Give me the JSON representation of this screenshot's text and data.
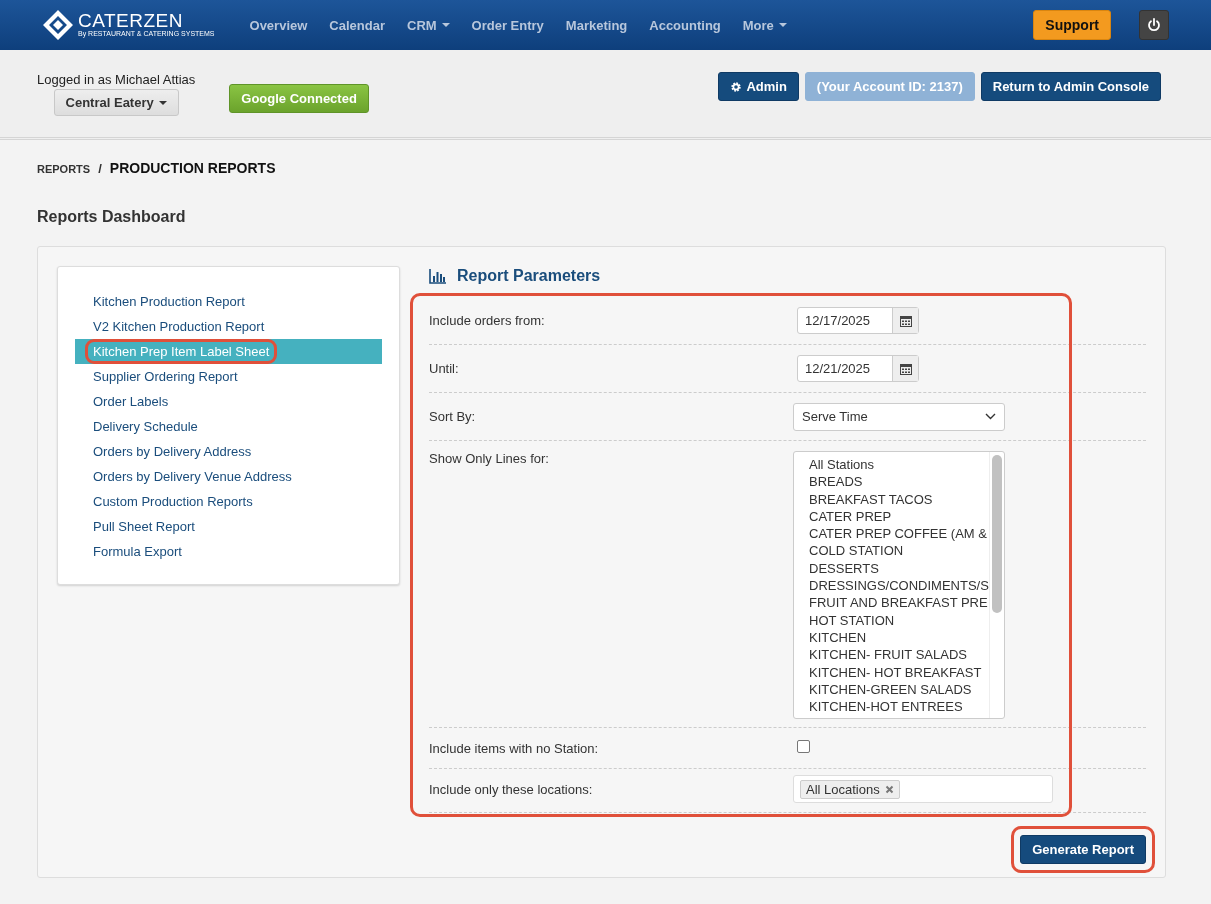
{
  "nav": {
    "logo": "CATERZEN",
    "tagline": "By RESTAURANT & CATERING SYSTEMS",
    "items": [
      {
        "label": "Overview",
        "dropdown": false
      },
      {
        "label": "Calendar",
        "dropdown": false
      },
      {
        "label": "CRM",
        "dropdown": true
      },
      {
        "label": "Order Entry",
        "dropdown": false
      },
      {
        "label": "Marketing",
        "dropdown": false
      },
      {
        "label": "Accounting",
        "dropdown": false
      },
      {
        "label": "More",
        "dropdown": true
      }
    ],
    "support": "Support"
  },
  "header": {
    "logged_in": "Logged in as Michael Attias",
    "location": "Central Eatery",
    "google": "Google Connected",
    "admin": "Admin",
    "account_id": "(Your Account ID: 2137)",
    "account_disabled": true,
    "return": "Return to Admin Console"
  },
  "breadcrumb": {
    "parent": "REPORTS",
    "separator": "/",
    "current": "PRODUCTION REPORTS"
  },
  "page_title": "Reports Dashboard",
  "reports": [
    {
      "label": "Kitchen Production Report",
      "selected": false,
      "annotated": false
    },
    {
      "label": "V2 Kitchen Production Report",
      "selected": false,
      "annotated": false
    },
    {
      "label": "Kitchen Prep Item Label Sheet",
      "selected": true,
      "annotated": true
    },
    {
      "label": "Supplier Ordering Report",
      "selected": false,
      "annotated": false
    },
    {
      "label": "Order Labels",
      "selected": false,
      "annotated": false
    },
    {
      "label": "Delivery Schedule",
      "selected": false,
      "annotated": false
    },
    {
      "label": "Orders by Delivery Address",
      "selected": false,
      "annotated": false
    },
    {
      "label": "Orders by Delivery Venue Address",
      "selected": false,
      "annotated": false
    },
    {
      "label": "Custom Production Reports",
      "selected": false,
      "annotated": false
    },
    {
      "label": "Pull Sheet Report",
      "selected": false,
      "annotated": false
    },
    {
      "label": "Formula Export",
      "selected": false,
      "annotated": false
    }
  ],
  "parameters": {
    "title": "Report Parameters",
    "annotated": true,
    "fields": [
      {
        "kind": "date",
        "label": "Include orders from:",
        "value": "12/17/2025"
      },
      {
        "kind": "date",
        "label": "Until:",
        "value": "12/21/2025"
      },
      {
        "kind": "select",
        "label": "Sort By:",
        "value": "Serve Time"
      },
      {
        "kind": "listbox",
        "label": "Show Only Lines for:",
        "options": [
          "All Stations",
          "BREADS",
          "BREAKFAST TACOS",
          "CATER PREP",
          "CATER PREP COFFEE (AM &",
          "COLD STATION",
          "DESSERTS",
          "DRESSINGS/CONDIMENTS/S",
          "FRUIT AND BREAKFAST PRE",
          "HOT STATION",
          "KITCHEN",
          "KITCHEN- FRUIT SALADS",
          "KITCHEN- HOT BREAKFAST",
          "KITCHEN-GREEN SALADS",
          "KITCHEN-HOT ENTREES"
        ]
      },
      {
        "kind": "checkbox",
        "label": "Include items with no Station:",
        "checked": false
      },
      {
        "kind": "tags",
        "label": "Include only these locations:",
        "tags": [
          "All Locations"
        ]
      }
    ]
  },
  "generate": {
    "label": "Generate Report",
    "annotated": true
  }
}
